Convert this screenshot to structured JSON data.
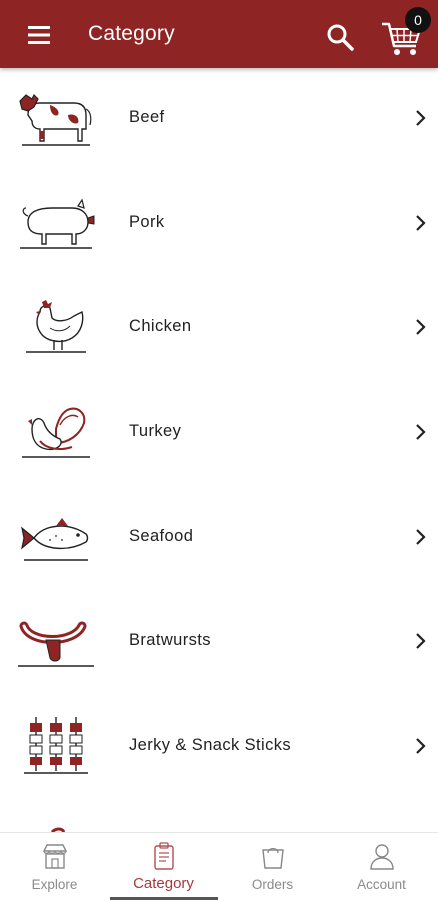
{
  "appbar": {
    "title": "Category",
    "icons": [
      "menu-icon",
      "search-icon",
      "shopping-cart-icon"
    ],
    "cart_count": "0",
    "bg_color": "#8e2424"
  },
  "categories": [
    {
      "label": "Beef",
      "icon": "cow-icon"
    },
    {
      "label": "Pork",
      "icon": "pig-icon"
    },
    {
      "label": "Chicken",
      "icon": "chicken-icon"
    },
    {
      "label": "Turkey",
      "icon": "turkey-icon"
    },
    {
      "label": "Seafood",
      "icon": "fish-icon"
    },
    {
      "label": "Bratwursts",
      "icon": "sausage-icon"
    },
    {
      "label": "Jerky & Snack Sticks",
      "icon": "skewer-icon"
    }
  ],
  "bottom_nav": {
    "items": [
      {
        "label": "Explore",
        "icon": "store-icon",
        "active": false
      },
      {
        "label": "Category",
        "icon": "clipboard-icon",
        "active": true
      },
      {
        "label": "Orders",
        "icon": "shopping-bag-icon",
        "active": false
      },
      {
        "label": "Account",
        "icon": "user-icon",
        "active": false
      }
    ],
    "active_color": "#a33a3a"
  }
}
